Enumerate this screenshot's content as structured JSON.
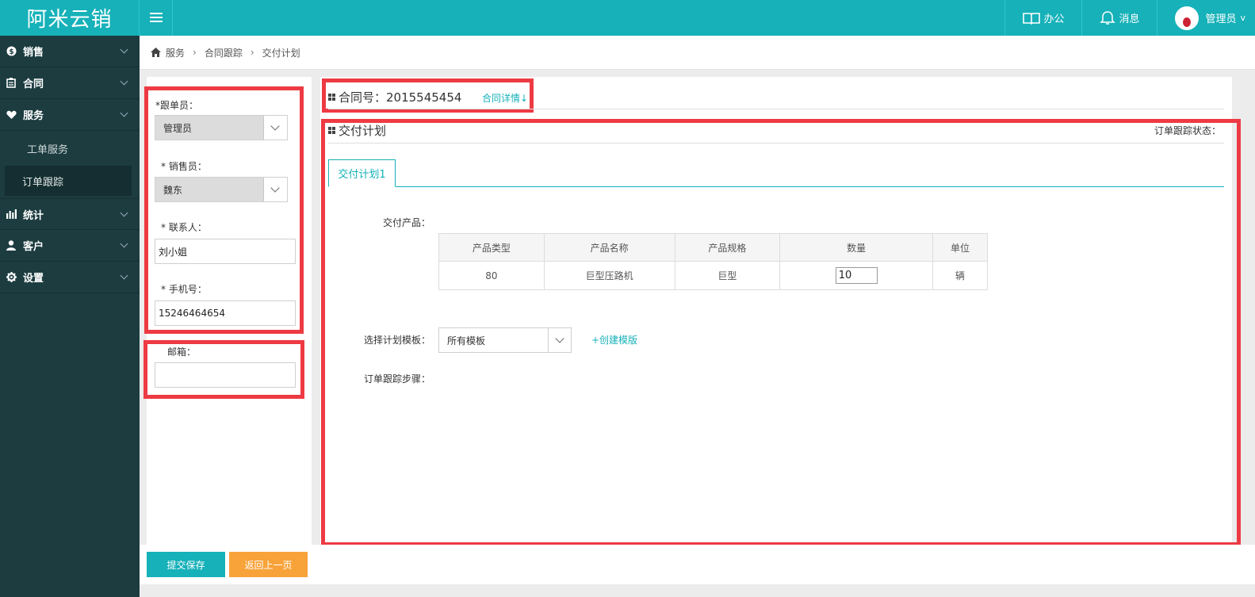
{
  "brand": {
    "logo_text": "阿米云销"
  },
  "topnav": {
    "office": "办公",
    "messages": "消息",
    "user": "管理员"
  },
  "sidebar": {
    "items": [
      {
        "label": "销售",
        "icon": "dollar-icon"
      },
      {
        "label": "合同",
        "icon": "contract-icon"
      },
      {
        "label": "服务",
        "icon": "heart-icon"
      },
      {
        "label": "统计",
        "icon": "bar-chart-icon"
      },
      {
        "label": "客户",
        "icon": "user-icon"
      },
      {
        "label": "设置",
        "icon": "gear-icon"
      }
    ],
    "service_sub": [
      {
        "label": "工单服务"
      },
      {
        "label": "订单跟踪"
      }
    ]
  },
  "breadcrumb": {
    "items": [
      "服务",
      "合同跟踪",
      "交付计划"
    ]
  },
  "form": {
    "follower_label": "*跟单员：",
    "follower_value": "管理员",
    "salesperson_label": "*  销售员：",
    "salesperson_value": "魏东",
    "contact_label": "*  联系人：",
    "contact_value": "刘小姐",
    "phone_label": "*  手机号：",
    "phone_value": "15246464654",
    "email_label": "邮箱：",
    "email_value": ""
  },
  "contract": {
    "title": "合同号：2015545454",
    "detail_link": "合同详情↓"
  },
  "plan": {
    "title": "交付计划",
    "status_label": "订单跟踪状态：",
    "tab": "交付计划1",
    "products_label": "交付产品：",
    "table": {
      "headers": [
        "产品类型",
        "产品名称",
        "产品规格",
        "数量",
        "单位"
      ],
      "rows": [
        {
          "type": "80",
          "name": "巨型压路机",
          "spec": "巨型",
          "qty": "10",
          "unit": "辆"
        }
      ]
    },
    "template_label": "选择计划模板：",
    "template_value": "所有模板",
    "create_template": "+创建模版",
    "steps_label": "订单跟踪步骤："
  },
  "buttons": {
    "submit": "提交保存",
    "back": "返回上一页"
  },
  "colors": {
    "teal": "#16b1b9",
    "sidebar": "#1c3c40",
    "red_highlight": "#ee3a43",
    "orange": "#f8a33a"
  }
}
